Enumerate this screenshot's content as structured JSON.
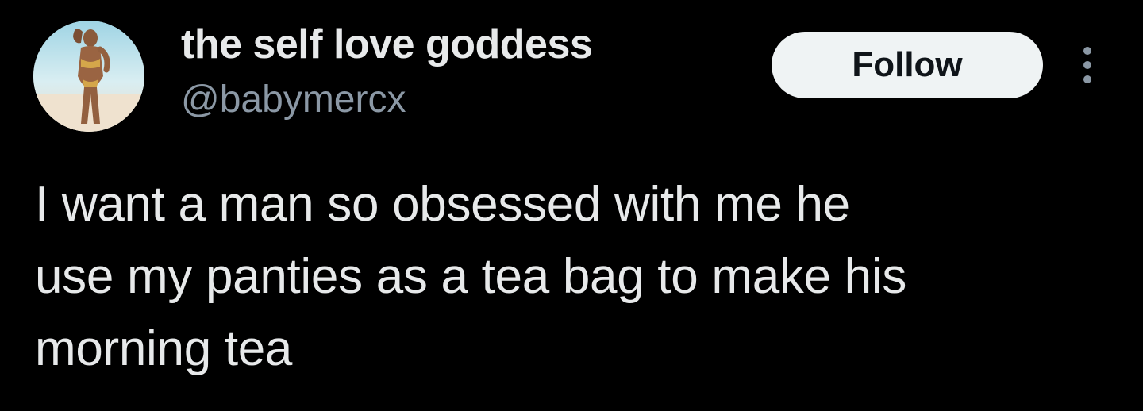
{
  "author": {
    "display_name": "the self love goddess",
    "handle": "@babymercx"
  },
  "actions": {
    "follow_label": "Follow"
  },
  "icons": {
    "avatar": "avatar-photo",
    "more": "more-vertical-icon"
  },
  "tweet": {
    "lines": [
      "I want a man so obsessed with me he",
      "use my panties as a tea bag to make his",
      "morning tea"
    ]
  },
  "colors": {
    "background": "#000000",
    "primary_text": "#e7e9ea",
    "secondary_text": "#8b98a5",
    "follow_button_bg": "#eff3f4",
    "follow_button_text": "#0f1419"
  }
}
